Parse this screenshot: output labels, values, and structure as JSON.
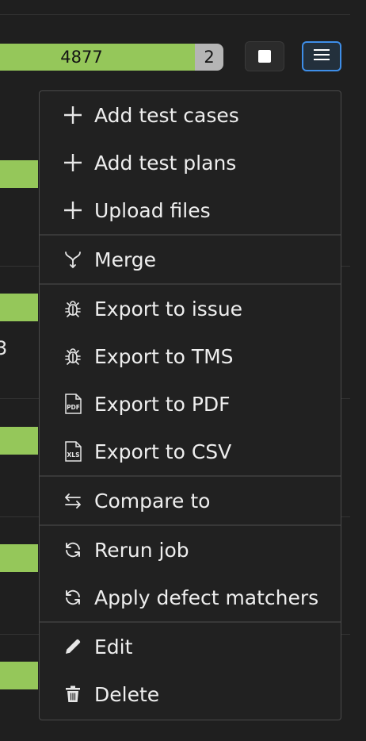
{
  "stats": {
    "passed_count": "4877",
    "unknown_count": "2",
    "passed_color": "#95c75a",
    "unknown_color": "#b5b5b5"
  },
  "side_value": "3",
  "toolbar": {
    "stop_icon": "stop-icon",
    "menu_icon": "hamburger-menu-icon",
    "accent_color": "#3e8ee8"
  },
  "menu": {
    "groups": [
      [
        {
          "icon": "plus-icon",
          "label": "Add test cases"
        },
        {
          "icon": "plus-icon",
          "label": "Add test plans"
        },
        {
          "icon": "plus-icon",
          "label": "Upload files"
        }
      ],
      [
        {
          "icon": "merge-icon",
          "label": "Merge"
        }
      ],
      [
        {
          "icon": "bug-icon",
          "label": "Export to issue"
        },
        {
          "icon": "bug-icon",
          "label": "Export to TMS"
        },
        {
          "icon": "pdf-file-icon",
          "label": "Export to PDF"
        },
        {
          "icon": "xls-file-icon",
          "label": "Export to CSV"
        }
      ],
      [
        {
          "icon": "compare-arrows-icon",
          "label": "Compare to"
        }
      ],
      [
        {
          "icon": "refresh-icon",
          "label": "Rerun job"
        },
        {
          "icon": "refresh-icon",
          "label": "Apply defect matchers"
        }
      ],
      [
        {
          "icon": "pencil-icon",
          "label": "Edit"
        },
        {
          "icon": "trash-icon",
          "label": "Delete"
        }
      ]
    ]
  }
}
